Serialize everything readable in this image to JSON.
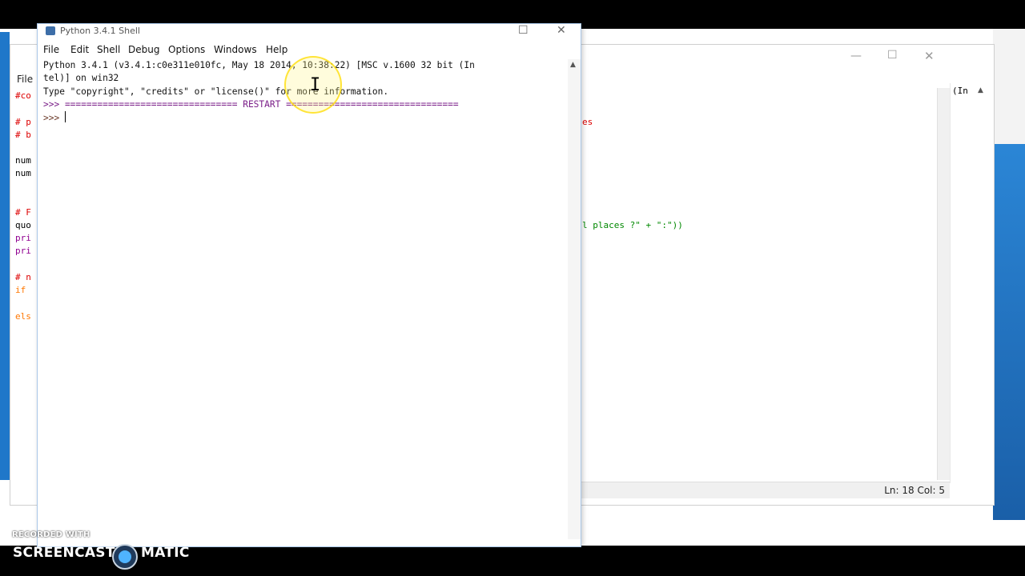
{
  "shell": {
    "title": "Python 3.4.1 Shell",
    "menu": [
      "File",
      "Edit",
      "Shell",
      "Debug",
      "Options",
      "Windows",
      "Help"
    ],
    "lines": [
      "Python 3.4.1 (v3.4.1:c0e311e010fc, May 18 2014, 10:38:22) [MSC v.1600 32 bit (In",
      "tel)] on win32",
      "Type \"copyright\", \"credits\" or \"license()\" for more information.",
      ">>> ================================ RESTART ================================",
      ">>> "
    ]
  },
  "editor": {
    "menu_first": "File",
    "code_left": [
      "#co",
      "# p",
      "# b",
      "num",
      "num",
      "# F",
      "quo",
      "pri",
      "pri",
      "# n",
      "if",
      "els"
    ],
    "code_right": [
      "es",
      "l places ?\" + \":\"))"
    ],
    "status": "Ln: 18 Col: 5",
    "right_header": "(In"
  },
  "watermark": {
    "recorded": "RECORDED WITH",
    "brand_left": "SCREENCAST",
    "brand_right": "MATIC"
  },
  "colors": {
    "comment": "#dd0000",
    "keyword": "#ff7700",
    "builtin": "#900090",
    "output": "#1c3a87"
  }
}
